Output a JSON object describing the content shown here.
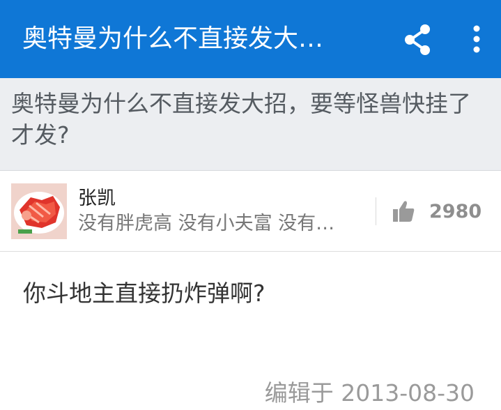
{
  "appbar": {
    "title": "奥特曼为什么不直接发大…",
    "share_icon": "share-icon",
    "more_icon": "more-vertical-icon",
    "background": "#0f77d6"
  },
  "question": {
    "text": "奥特曼为什么不直接发大招，要等怪兽快挂了才发?"
  },
  "author": {
    "name": "张凯",
    "bio": "没有胖虎高 没有小夫富 没有…",
    "avatar_icon": "avatar-food-photo"
  },
  "vote": {
    "icon": "thumbs-up-icon",
    "count": "2980"
  },
  "answer": {
    "text": "你斗地主直接扔炸弹啊?",
    "edited": "编辑于 2013-08-30"
  }
}
